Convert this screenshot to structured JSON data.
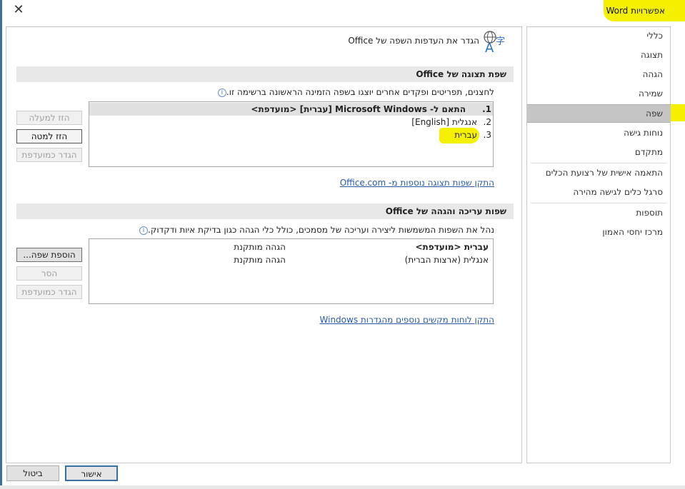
{
  "window": {
    "title": "אפשרויות Word",
    "close_glyph": "✕"
  },
  "nav": {
    "items": [
      {
        "label": "כללי"
      },
      {
        "label": "תצוגה"
      },
      {
        "label": "הגהה"
      },
      {
        "label": "שמירה"
      },
      {
        "label": "שפה",
        "selected": true
      },
      {
        "label": "נוחות גישה"
      },
      {
        "label": "מתקדם"
      },
      {
        "label": "התאמה אישית של רצועת הכלים"
      },
      {
        "label": "סרגל כלים לגישה מהירה"
      },
      {
        "label": "תוספות"
      },
      {
        "label": "מרכז יחסי האמון"
      }
    ]
  },
  "header": {
    "title": "הגדר את העדפות השפה של Office",
    "icon": "language-icon"
  },
  "display": {
    "section_title": "שפת תצוגה של Office",
    "description": "לחצנים, תפריטים ופקדים אחרים יוצגו בשפה הזמינה הראשונה ברשימה זו.",
    "items": [
      {
        "num": "1.",
        "label": "התאם ל- Microsoft Windows [עברית] <מועדפת>",
        "selected": true
      },
      {
        "num": "2.",
        "label": "אנגלית [English]"
      },
      {
        "num": "3.",
        "label": "עברית"
      }
    ],
    "buttons": {
      "move_up": "הזז למעלה",
      "move_down": "הזז למטה",
      "set_preferred": "הגדר כמועדפת"
    },
    "link": "התקן שפות תצוגה נוספות מ- Office.com"
  },
  "editing": {
    "section_title": "שפות עריכה והגהה של Office",
    "description": "נהל את השפות המשמשות ליצירה ועריכה של מסמכים, כולל כלי הגהה כגון בדיקת איות ודקדוק.",
    "rows": [
      {
        "language": "עברית <מועדפת>",
        "status": "הגהה מותקנת",
        "bold": true
      },
      {
        "language": "אנגלית (ארצות הברית)",
        "status": "הגהה מותקנת"
      }
    ],
    "buttons": {
      "add": "הוספת שפה...",
      "remove": "הסר",
      "set_preferred": "הגדר כמועדפת"
    },
    "link": "התקן לוחות מקשים נוספים מהגדרות Windows"
  },
  "footer": {
    "ok": "אישור",
    "cancel": "ביטול"
  }
}
